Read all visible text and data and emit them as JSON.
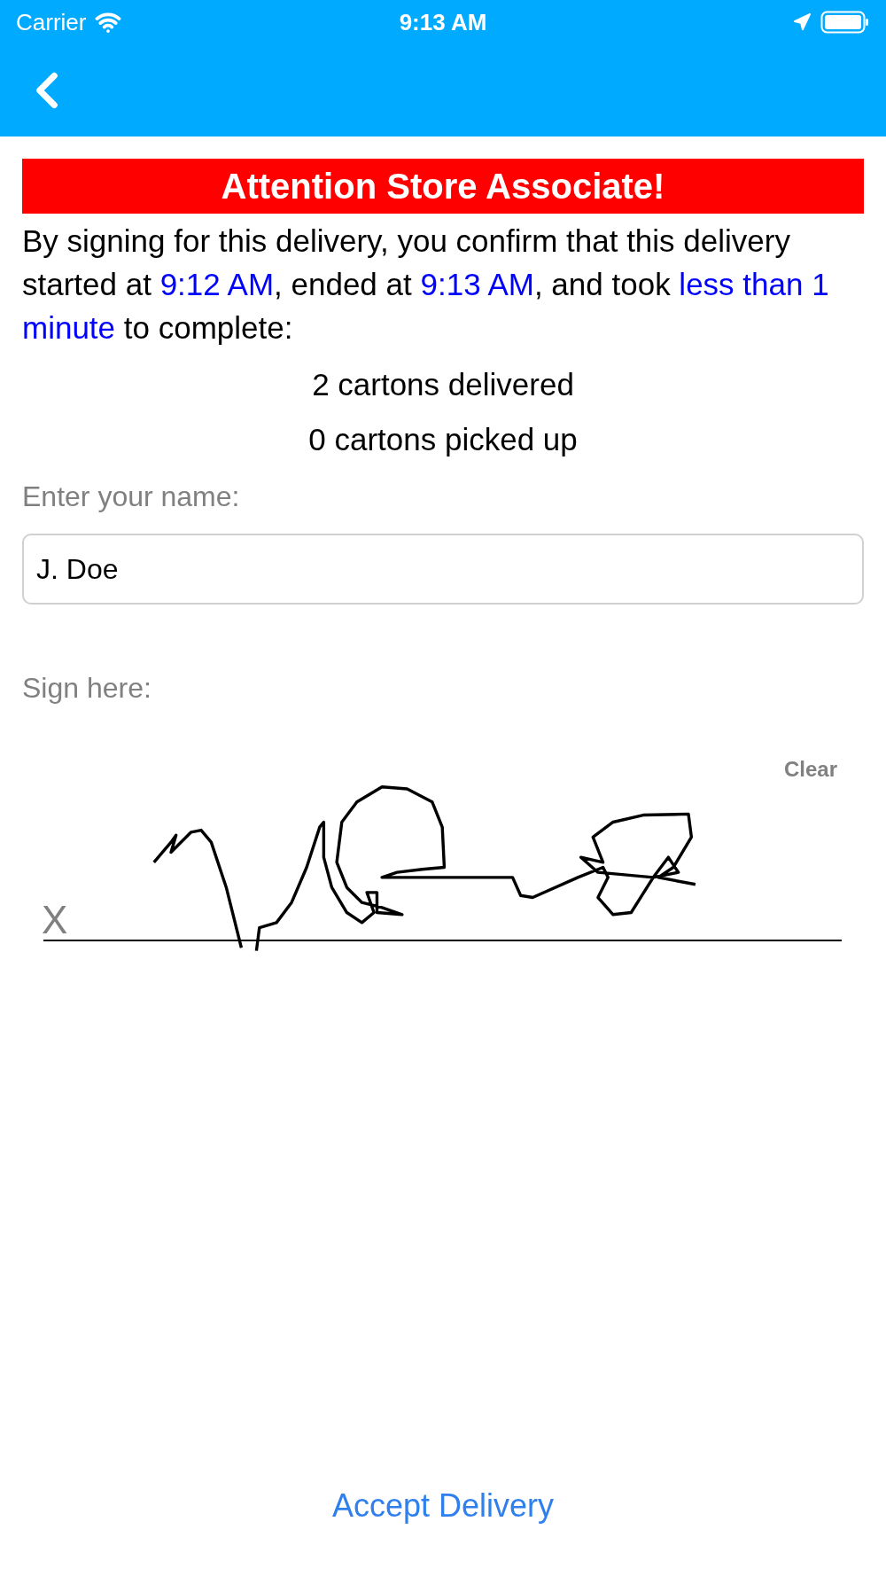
{
  "status_bar": {
    "carrier": "Carrier",
    "time": "9:13 AM"
  },
  "banner": "Attention Store Associate!",
  "confirmation": [
    {
      "text": "By signing for this delivery, you confirm that this delivery started at ",
      "kind": "plain"
    },
    {
      "text": "9:12 AM",
      "kind": "highlight"
    },
    {
      "text": ", ended at ",
      "kind": "plain"
    },
    {
      "text": "9:13 AM",
      "kind": "highlight"
    },
    {
      "text": ", and took ",
      "kind": "plain"
    },
    {
      "text": "less than 1 minute",
      "kind": "highlight"
    },
    {
      "text": " to complete:",
      "kind": "plain"
    }
  ],
  "counts": [
    "2 cartons delivered",
    "0 cartons picked up"
  ],
  "name_label": "Enter your name:",
  "name_field": {
    "value": "J. Doe"
  },
  "sign_label": "Sign here:",
  "clear_button": "Clear",
  "signature_mark": "X",
  "accept_button": "Accept Delivery"
}
